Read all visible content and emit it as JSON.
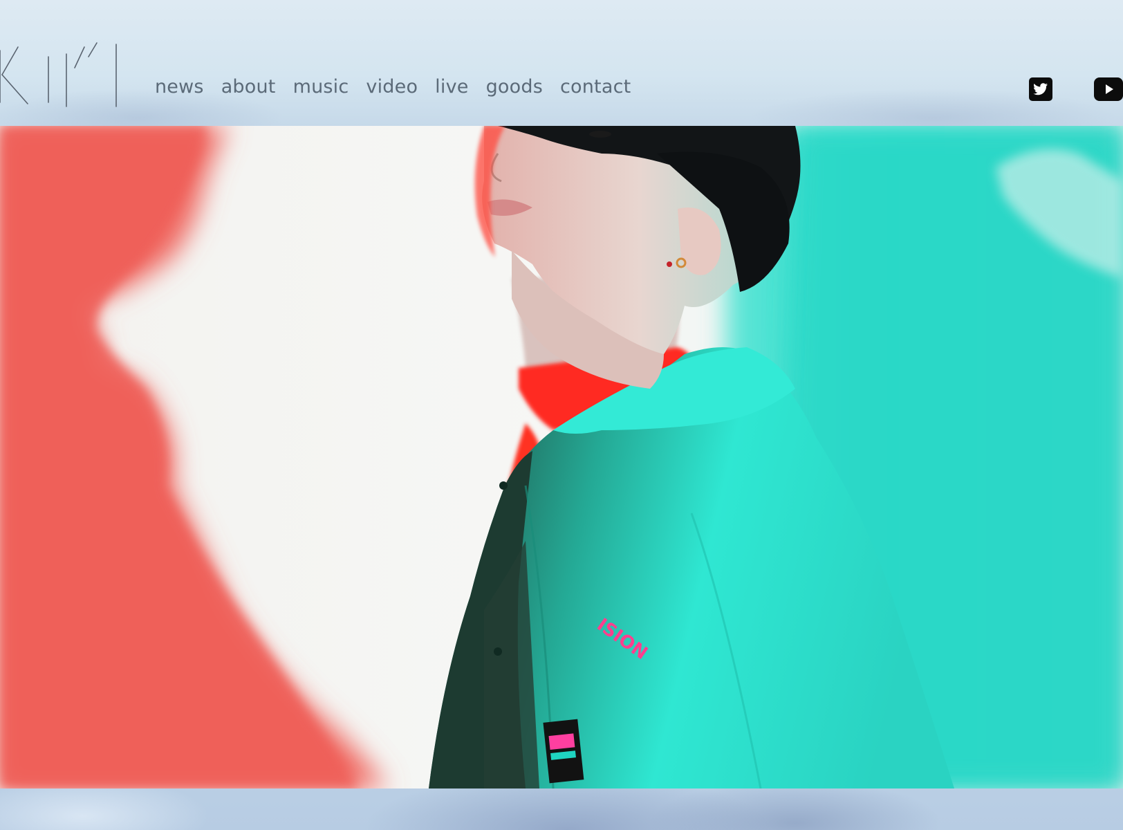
{
  "site": {
    "logo_alt": "KIKI logo"
  },
  "nav": {
    "items": [
      {
        "label": "news"
      },
      {
        "label": "about"
      },
      {
        "label": "music"
      },
      {
        "label": "video"
      },
      {
        "label": "live"
      },
      {
        "label": "goods"
      },
      {
        "label": "contact"
      }
    ]
  },
  "social": {
    "twitter_icon": "twitter-icon",
    "youtube_icon": "youtube-icon"
  },
  "hero": {
    "image_alt": "artist portrait with red and cyan lighting",
    "jacket_print": "ISION"
  },
  "colors": {
    "nav_text": "#5b6a78",
    "header_bg": "#d4e5f0",
    "red_light": "#f06b63",
    "cyan_light": "#22e0cf"
  }
}
